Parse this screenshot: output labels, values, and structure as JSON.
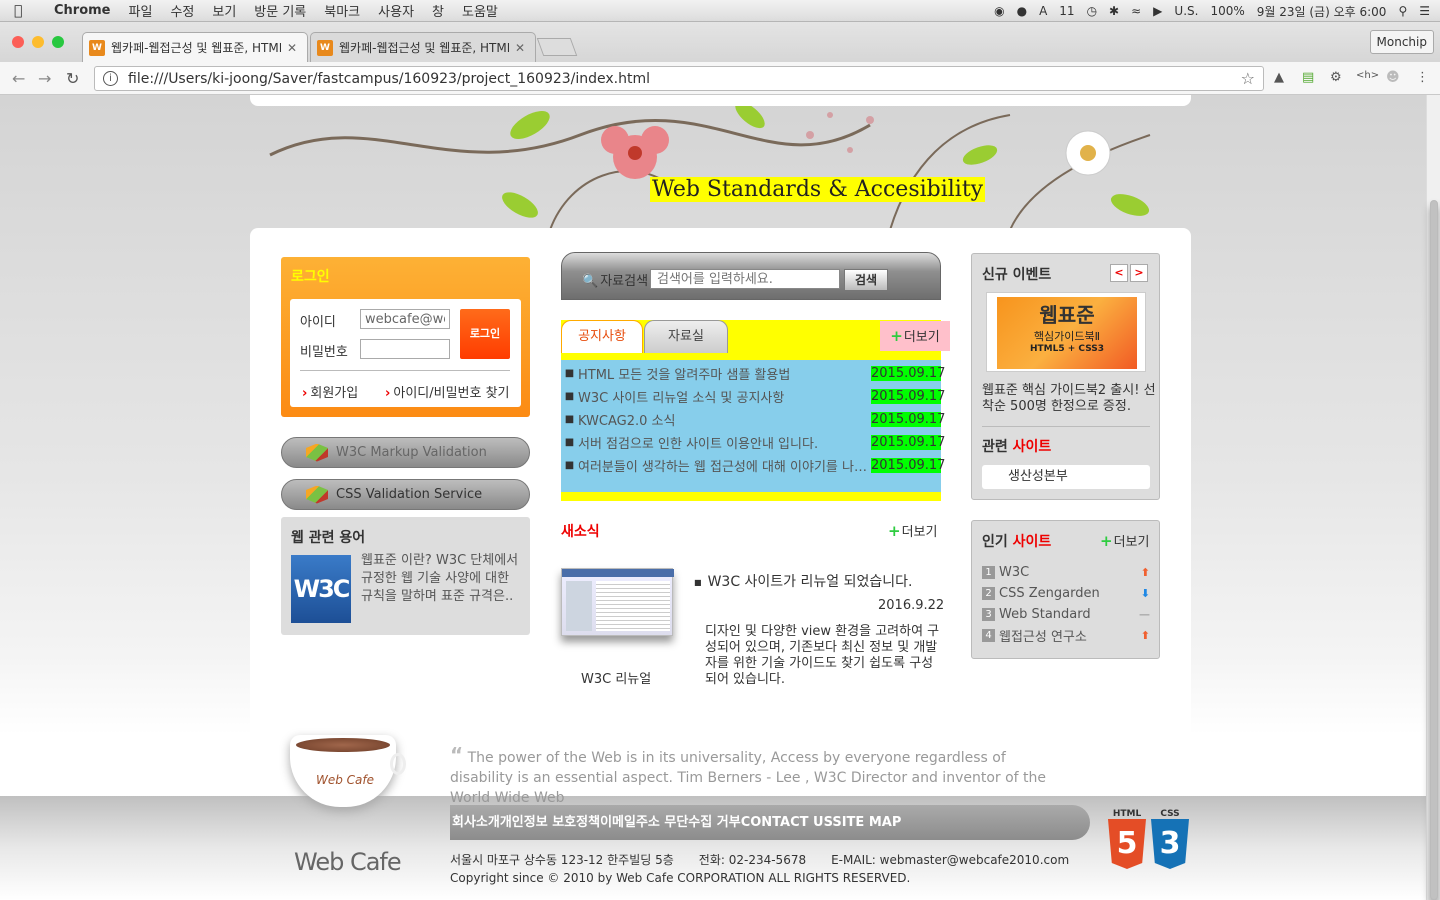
{
  "menubar": {
    "app": "Chrome",
    "items": [
      "파일",
      "수정",
      "보기",
      "방문 기록",
      "북마크",
      "사용자",
      "창",
      "도움말"
    ],
    "status": {
      "battery_num": "11",
      "input_source": "U.S.",
      "battery": "100%",
      "clock": "9월 23일 (금) 오후 6:00"
    }
  },
  "tabs": [
    {
      "title": "웹카페-웹접근성 및 웹표준, HTML5"
    },
    {
      "title": "웹카페-웹접근성 및 웹표준, HTML5"
    }
  ],
  "profile": "Monchip",
  "address": "file:///Users/ki-joong/Saver/fastcampus/160923/project_160923/index.html",
  "header": {
    "slogan": "Web Standards & Accesibility"
  },
  "login": {
    "title": "로그인",
    "id_label": "아이디",
    "id_value": "webcafe@webcafe.com",
    "pw_label": "비밀번호",
    "submit": "로그인",
    "join": "회원가입",
    "find": "아이디/비밀번호 찾기"
  },
  "validation": {
    "markup": "W3C Markup Validation",
    "css": "CSS Validation Service"
  },
  "terms": {
    "title": "웹 관련 용어",
    "logo": "W3C",
    "text": "웹표준 이란? W3C 단체에서 규정한 웹 기술 사양에 대한 규칙을 말하며 표준 규격은.."
  },
  "search": {
    "label": "자료검색",
    "placeholder": "검색어를 입력하세요.",
    "button": "검색"
  },
  "notice": {
    "tab_active": "공지사항",
    "tab_inactive": "자료실",
    "more": "더보기",
    "items": [
      {
        "title": "HTML 모든 것을 알려주마 샘플 활용법",
        "date": "2015.09.17"
      },
      {
        "title": "W3C 사이트 리뉴얼 소식 및 공지사항",
        "date": "2015.09.17"
      },
      {
        "title": "KWCAG2.0 소식",
        "date": "2015.09.17"
      },
      {
        "title": "서버 점검으로 인한 사이트 이용안내 입니다.",
        "date": "2015.09.17"
      },
      {
        "title": "여러분들이 생각하는 웹 접근성에 대해 이야기를 나눠봐요",
        "date": "2015.09.17"
      }
    ]
  },
  "news": {
    "title": "새소식",
    "more": "더보기",
    "caption": "W3C 리뉴얼",
    "headline": "W3C 사이트가 리뉴얼 되었습니다.",
    "date": "2016.9.22",
    "body": "디자인 및 다양한 view 환경을 고려하여 구성되어 있으며, 기존보다 최신 정보 및 개발자를 위한 기술 가이드도 찾기 쉽도록 구성되어 있습니다."
  },
  "event": {
    "title": "신규 이벤트",
    "book_title": "웹표준",
    "book_sub": "핵심가이드북Ⅱ",
    "book_tag": "HTML5 + CSS3",
    "text": "웹표준 핵심 가이드북2 출시! 선착순 500명 한정으로 증정.",
    "related_title_a": "관련",
    "related_title_b": "사이트",
    "related_site": "생산성본부"
  },
  "popular": {
    "title_a": "인기",
    "title_b": "사이트",
    "more": "더보기",
    "items": [
      {
        "rank": "1",
        "name": "W3C",
        "trend": "up"
      },
      {
        "rank": "2",
        "name": "CSS Zengarden",
        "trend": "down"
      },
      {
        "rank": "3",
        "name": "Web Standard",
        "trend": "same"
      },
      {
        "rank": "4",
        "name": "웹접근성 연구소",
        "trend": "up"
      }
    ]
  },
  "quote": "The power of the Web is in its universality, Access by everyone regardless of disability is an essential aspect. Tim Berners - Lee , W3C Director and inventor of the World Wide Web",
  "footer": {
    "brand": "Web Cafe",
    "cup_text": "Web Cafe",
    "menu": [
      "회사소개",
      "개인정보 보호정책",
      "이메일주소 무단수집 거부",
      "CONTACT US",
      "SITE MAP"
    ],
    "address": "서울시 마포구 상수동 123-12 한주빌딩 5층",
    "phone": "전화: 02-234-5678",
    "email": "E-MAIL: webmaster@webcafe2010.com",
    "copyright": "Copyright since © 2010 by Web Cafe CORPORATION ALL RIGHTS RESERVED.",
    "badge_html": "HTML",
    "badge_html_num": "5",
    "badge_css": "CSS",
    "badge_css_num": "3"
  },
  "colors": {
    "html5": "#e44d26",
    "css3": "#1572b6",
    "notice_bg": "#ffff00",
    "list_bg": "#87ceeb",
    "date_bg": "#00ff00"
  }
}
